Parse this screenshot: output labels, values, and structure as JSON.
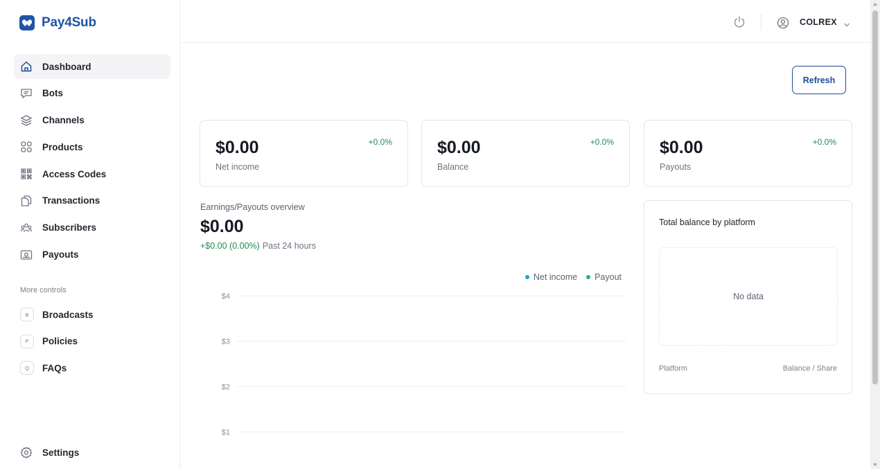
{
  "brand": {
    "name": "Pay4Sub",
    "color": "#1f55a5"
  },
  "sidebar": {
    "items": [
      {
        "label": "Dashboard",
        "icon": "home-icon",
        "active": true
      },
      {
        "label": "Bots",
        "icon": "message-icon"
      },
      {
        "label": "Channels",
        "icon": "layers-icon"
      },
      {
        "label": "Products",
        "icon": "grid-icon"
      },
      {
        "label": "Access Codes",
        "icon": "qr-code-icon"
      },
      {
        "label": "Transactions",
        "icon": "copy-icon"
      },
      {
        "label": "Subscribers",
        "icon": "users-icon"
      },
      {
        "label": "Payouts",
        "icon": "money-icon"
      }
    ],
    "more_title": "More controls",
    "more_items": [
      {
        "letter": "B",
        "label": "Broadcasts"
      },
      {
        "letter": "P",
        "label": "Policies"
      },
      {
        "letter": "Q",
        "label": "FAQs"
      }
    ],
    "settings_label": "Settings"
  },
  "header": {
    "user_name": "COLREX",
    "power_icon": "power-icon",
    "user_icon": "user-circle-icon",
    "chevron_icon": "chevron-down-icon"
  },
  "toolbar": {
    "refresh_label": "Refresh"
  },
  "stats": [
    {
      "value": "$0.00",
      "label": "Net income",
      "change": "+0.0%"
    },
    {
      "value": "$0.00",
      "label": "Balance",
      "change": "+0.0%"
    },
    {
      "value": "$0.00",
      "label": "Payouts",
      "change": "+0.0%"
    }
  ],
  "overview": {
    "title": "Earnings/Payouts overview",
    "value": "$0.00",
    "change": "+$0.00 (0.00%)",
    "period": "Past 24 hours"
  },
  "chart_data": {
    "type": "line",
    "title": "",
    "series": [
      {
        "name": "Net income",
        "color": "#1aa3dc",
        "values": []
      },
      {
        "name": "Payout",
        "color": "#1fb47a",
        "values": []
      }
    ],
    "y_ticks": [
      "$4",
      "$3",
      "$2",
      "$1"
    ],
    "y_tick_values": [
      4,
      3,
      2,
      1
    ],
    "legend_position": "top-right",
    "grid": true
  },
  "platform": {
    "title": "Total balance by platform",
    "no_data": "No data",
    "col_platform": "Platform",
    "col_balance": "Balance / Share"
  },
  "colors": {
    "accent": "#1d4e8f",
    "positive": "#1e8a55",
    "net_income": "#1aa3dc",
    "payout": "#1fb47a"
  }
}
